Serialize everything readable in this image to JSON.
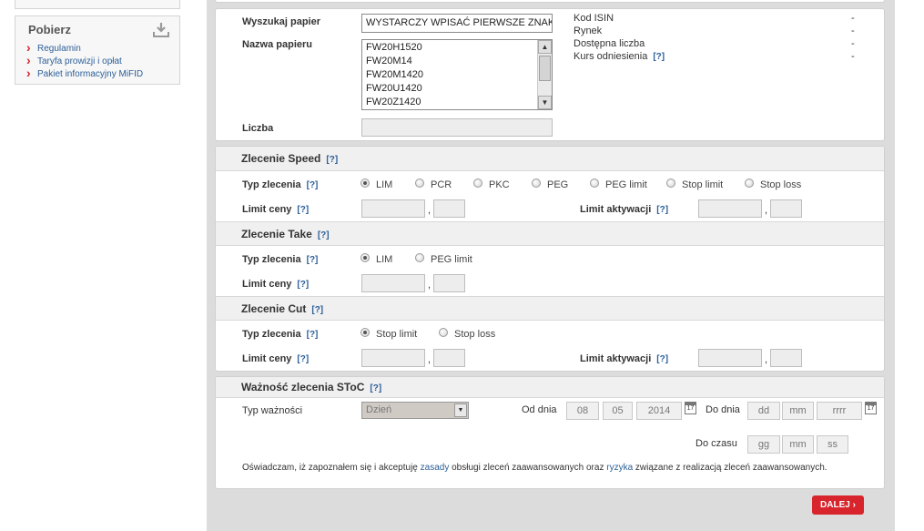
{
  "sidebar": {
    "title": "Pobierz",
    "links": [
      "Regulamin",
      "Taryfa prowizji i opłat",
      "Pakiet informacyjny MiFID"
    ]
  },
  "security": {
    "search_label": "Wyszukaj papier",
    "search_value": "WYSTARCZY WPISAĆ PIERWSZE ZNAKI",
    "name_label": "Nazwa papieru",
    "list_items": [
      "FW20H1520",
      "FW20M14",
      "FW20M1420",
      "FW20U1420",
      "FW20Z1420"
    ],
    "quantity_label": "Liczba",
    "info": [
      {
        "label": "Kod ISIN",
        "value": "-"
      },
      {
        "label": "Rynek",
        "value": "-"
      },
      {
        "label": "Dostępna liczba",
        "value": "-"
      },
      {
        "label": "Kurs odniesienia",
        "value": "-"
      }
    ]
  },
  "help_text": "[?]",
  "comma": ",",
  "speed": {
    "title": "Zlecenie Speed",
    "type_label": "Typ zlecenia",
    "options": [
      "LIM",
      "PCR",
      "PKC",
      "PEG",
      "PEG limit",
      "Stop limit",
      "Stop loss"
    ],
    "selected": "LIM",
    "price_label": "Limit ceny",
    "activation_label": "Limit aktywacji"
  },
  "take": {
    "title": "Zlecenie Take",
    "type_label": "Typ zlecenia",
    "options": [
      "LIM",
      "PEG limit"
    ],
    "selected": "LIM",
    "price_label": "Limit ceny"
  },
  "cut": {
    "title": "Zlecenie Cut",
    "type_label": "Typ zlecenia",
    "options": [
      "Stop limit",
      "Stop loss"
    ],
    "selected": "Stop limit",
    "price_label": "Limit ceny",
    "activation_label": "Limit aktywacji"
  },
  "validity": {
    "title": "Ważność zlecenia SToC",
    "type_label": "Typ ważności",
    "type_value": "Dzień",
    "from_label": "Od dnia",
    "from_day": "08",
    "from_month": "05",
    "from_year": "2014",
    "to_label": "Do dnia",
    "to_day_placeholder": "dd",
    "to_month_placeholder": "mm",
    "to_year_placeholder": "rrrr",
    "calendar_day": "17",
    "time_label": "Do czasu",
    "hour_placeholder": "gg",
    "min_placeholder": "mm",
    "sec_placeholder": "ss",
    "agree_1": "Oświadczam, iż zapoznałem się i akceptuję",
    "agree_link_1": "zasady",
    "agree_2": "obsługi zleceń zaawansowanych oraz",
    "agree_link_2": "ryzyka",
    "agree_3": "związane z realizacją zleceń zaawansowanych."
  },
  "next_button": "DALEJ ›",
  "colors": {
    "accent": "#d8242c",
    "link": "#2d5f99"
  }
}
